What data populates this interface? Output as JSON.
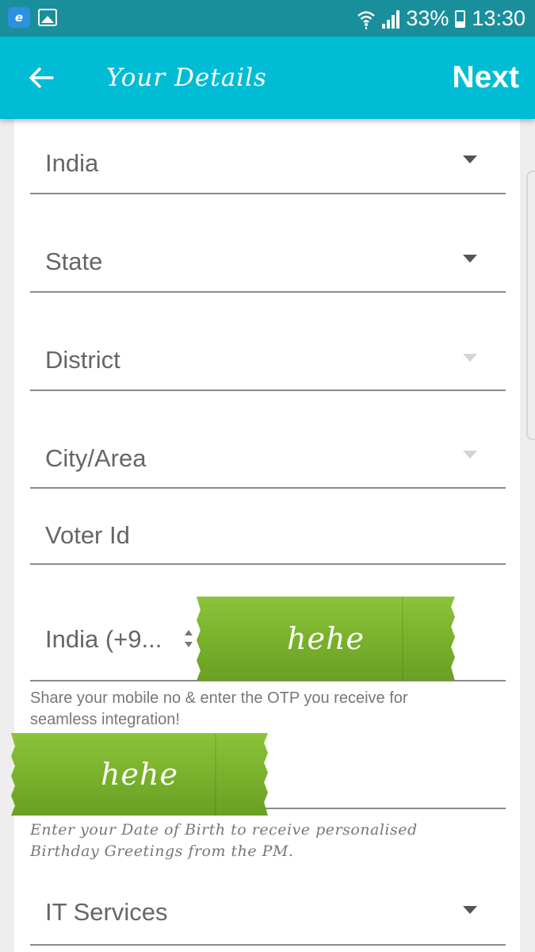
{
  "status_bar": {
    "battery": "33%",
    "time": "13:30"
  },
  "app_bar": {
    "title": "Your Details",
    "next_label": "Next"
  },
  "form": {
    "country": "India",
    "state": "State",
    "district": "District",
    "city": "City/Area",
    "voter_id_placeholder": "Voter Id",
    "phone_country_code": "India (+9...",
    "phone_helper": "Share your mobile no & enter the OTP you receive for seamless integration!",
    "dob_helper": "Enter your Date of Birth to receive personalised Birthday Greetings from the PM.",
    "profession": "IT Services"
  },
  "stickers": {
    "sticker_1": "hehe",
    "sticker_2": "hehe"
  },
  "colors": {
    "app_bar": "#00bcd4",
    "status_bar": "#1a8f9c",
    "sticker": "#7cb62e"
  }
}
